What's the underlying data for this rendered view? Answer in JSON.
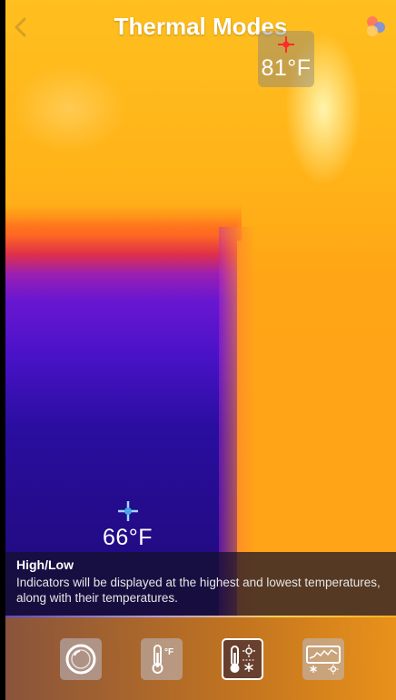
{
  "header": {
    "title": "Thermal Modes",
    "back_icon": "chevron-left-icon",
    "palette_icon": "color-palette-icon"
  },
  "markers": {
    "hot": {
      "temperature": "81°F",
      "icon": "crosshair-icon",
      "color": "#ff2a2a"
    },
    "cold": {
      "temperature": "66°F",
      "icon": "crosshair-icon",
      "color": "#7fc8ff"
    }
  },
  "info": {
    "title": "High/Low",
    "description": "Indicators will be displayed at the highest and lowest temperatures, along with their temperatures."
  },
  "modes": [
    {
      "name": "lens-icon",
      "selected": false
    },
    {
      "name": "thermometer-fahrenheit-icon",
      "selected": false
    },
    {
      "name": "high-low-thermometer-icon",
      "selected": true
    },
    {
      "name": "temperature-graph-icon",
      "selected": false
    }
  ],
  "colors": {
    "accent": "#ffa518",
    "cold": "#2a0ea0"
  }
}
